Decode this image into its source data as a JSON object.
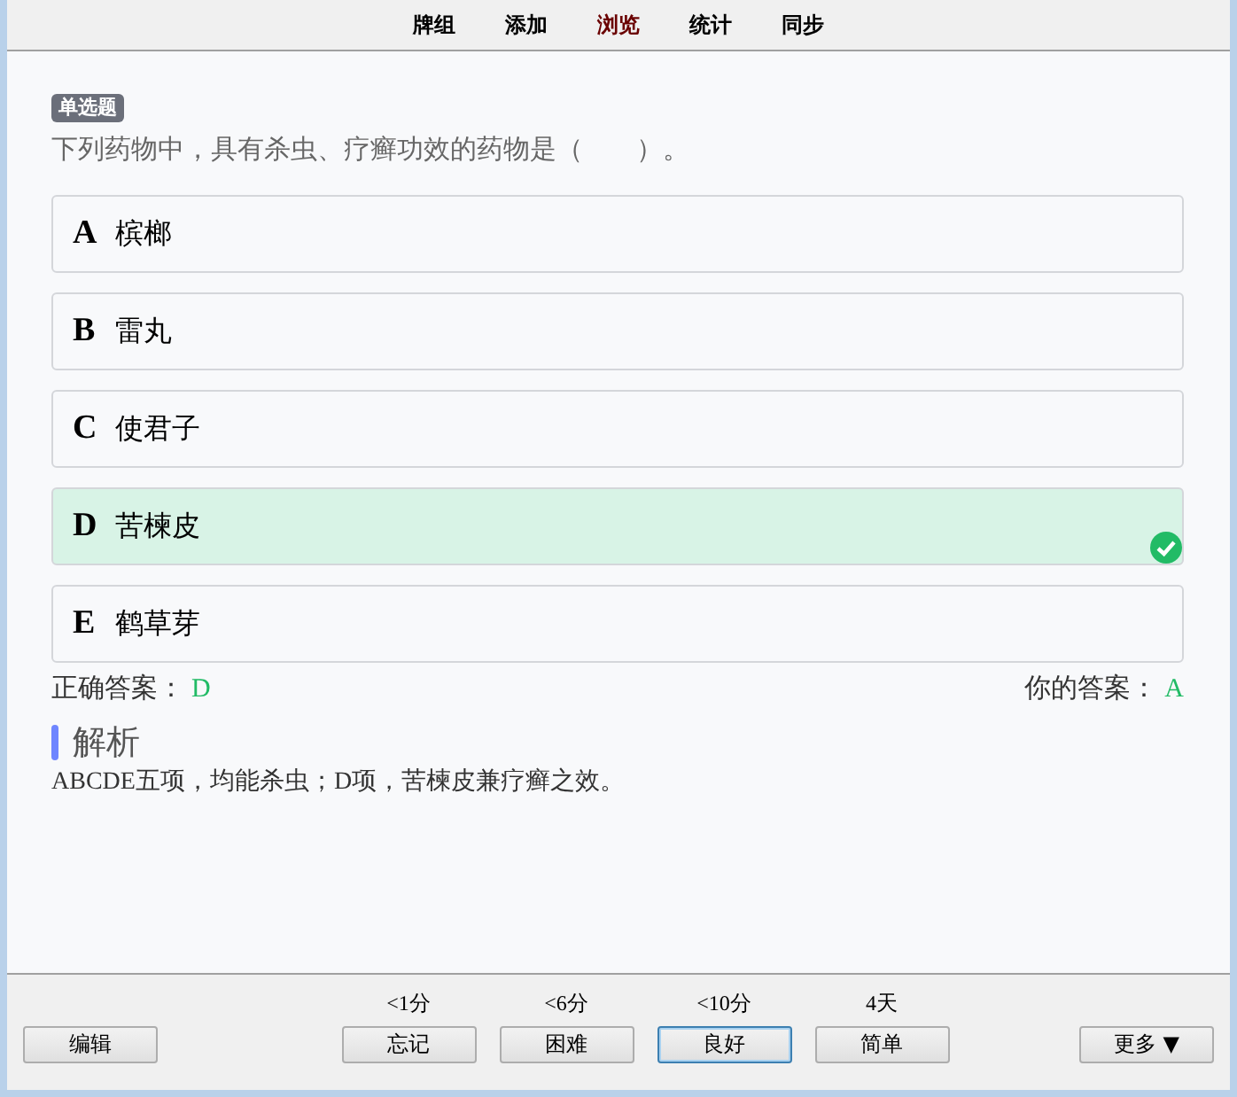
{
  "menu": [
    {
      "label": "牌组",
      "selected": false
    },
    {
      "label": "添加",
      "selected": false
    },
    {
      "label": "浏览",
      "selected": true
    },
    {
      "label": "统计",
      "selected": false
    },
    {
      "label": "同步",
      "selected": false
    }
  ],
  "question": {
    "tag": "单选题",
    "text": "下列药物中，具有杀虫、疗癣功效的药物是（　　）。"
  },
  "options": [
    {
      "letter": "A",
      "text": "槟榔",
      "correct": false
    },
    {
      "letter": "B",
      "text": "雷丸",
      "correct": false
    },
    {
      "letter": "C",
      "text": "使君子",
      "correct": false
    },
    {
      "letter": "D",
      "text": "苦楝皮",
      "correct": true
    },
    {
      "letter": "E",
      "text": "鹤草芽",
      "correct": false
    }
  ],
  "answers": {
    "correct_label": "正确答案：",
    "correct_value": "D",
    "yours_label": "你的答案：",
    "yours_value": "A"
  },
  "analysis": {
    "heading": "解析",
    "text": "ABCDE五项，均能杀虫；D项，苦楝皮兼疗癣之效。"
  },
  "bottom_bar": {
    "edit_button": "编辑",
    "ease_buttons": [
      {
        "interval": "<1分",
        "label": "忘记",
        "selected": false
      },
      {
        "interval": "<6分",
        "label": "困难",
        "selected": false
      },
      {
        "interval": "<10分",
        "label": "良好",
        "selected": true
      },
      {
        "interval": "4天",
        "label": "简单",
        "selected": false
      }
    ],
    "more_button": "更多 ▼"
  }
}
